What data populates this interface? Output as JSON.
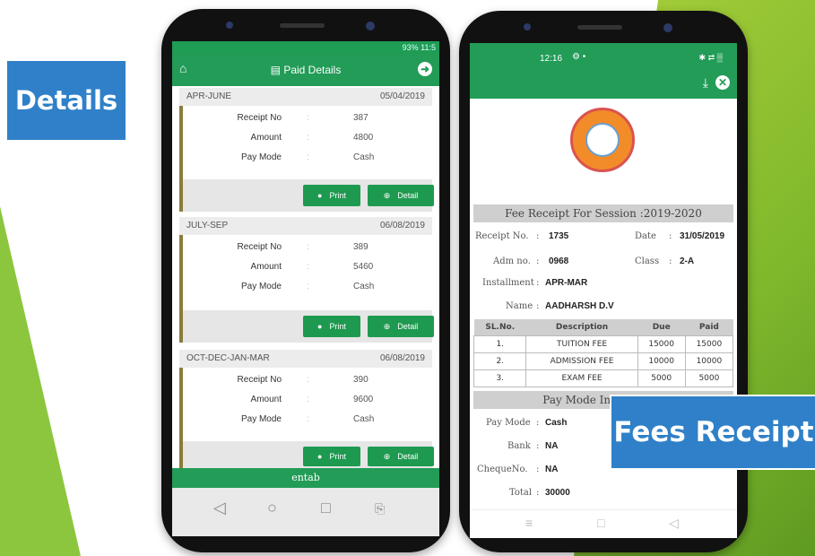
{
  "slide": {
    "details_tag": "Details",
    "fees_tag": "Fees Receipt"
  },
  "phone1": {
    "status": "93%  11:5",
    "app_bar_title": "Paid Details",
    "cards": [
      {
        "period": "APR-JUNE",
        "date": "05/04/2019",
        "receipt_label": "Receipt No",
        "receipt": "387",
        "amount_label": "Amount",
        "amount": "4800",
        "mode_label": "Pay Mode",
        "mode": "Cash"
      },
      {
        "period": "JULY-SEP",
        "date": "06/08/2019",
        "receipt_label": "Receipt No",
        "receipt": "389",
        "amount_label": "Amount",
        "amount": "5460",
        "mode_label": "Pay Mode",
        "mode": "Cash"
      },
      {
        "period": "OCT-DEC-JAN-MAR",
        "date": "06/08/2019",
        "receipt_label": "Receipt No",
        "receipt": "390",
        "amount_label": "Amount",
        "amount": "9600",
        "mode_label": "Pay Mode",
        "mode": "Cash"
      }
    ],
    "print_label": "Print",
    "detail_label": "Detail",
    "footer_brand": "entab",
    "separator": ":"
  },
  "phone2": {
    "time": "12:16",
    "receipt_title": "Fee Receipt For Session :2019-2020",
    "receipt_no_label": "Receipt No.",
    "receipt_no": "1735",
    "date_label": "Date",
    "date": "31/05/2019",
    "adm_label": "Adm no.",
    "adm": "0968",
    "class_label": "Class",
    "class": "2-A",
    "installment_label": "Installment",
    "installment": "APR-MAR",
    "name_label": "Name",
    "name": "AADHARSH D.V",
    "colon": ":",
    "table_headers": [
      "SL.No.",
      "Description",
      "Due",
      "Paid"
    ],
    "rows": [
      [
        "1.",
        "TUITION FEE",
        "15000",
        "15000"
      ],
      [
        "2.",
        "ADMISSION FEE",
        "10000",
        "10000"
      ],
      [
        "3.",
        "EXAM FEE",
        "5000",
        "5000"
      ]
    ],
    "paymode_title": "Pay Mode Information",
    "paymode_label": "Pay Mode",
    "paymode": "Cash",
    "bank_label": "Bank",
    "bank": "NA",
    "cheque_label": "ChequeNo.",
    "cheque": "NA",
    "total_label": "Total",
    "total": "30000"
  }
}
